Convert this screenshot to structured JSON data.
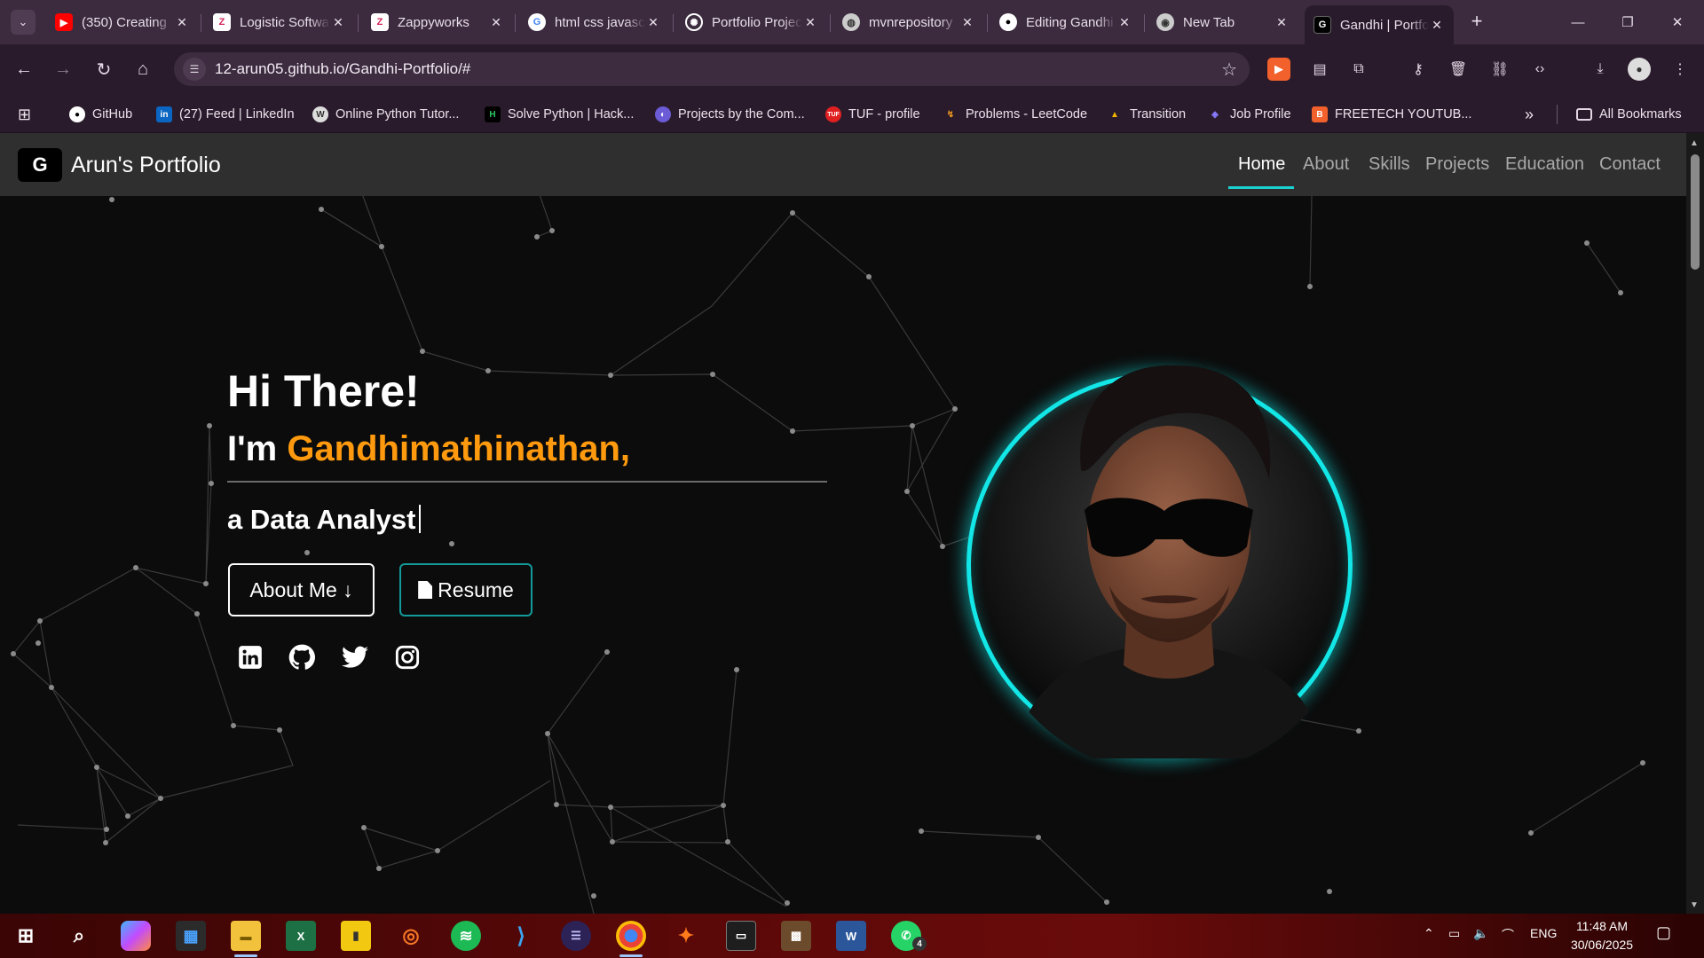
{
  "browser": {
    "tabs": [
      {
        "title": "(350) Creating",
        "icon": "youtube-icon",
        "color": "#ff0000"
      },
      {
        "title": "Logistic Software",
        "icon": "zappy-icon",
        "color": "#ffffff"
      },
      {
        "title": "Zappyworks",
        "icon": "zappy-icon",
        "color": "#ffffff"
      },
      {
        "title": "html css javascript",
        "icon": "google-icon",
        "color": "#ffffff"
      },
      {
        "title": "Portfolio Project",
        "icon": "openai-icon",
        "color": "#ffffff"
      },
      {
        "title": "mvnrepository",
        "icon": "globe-icon",
        "color": "#ffffff"
      },
      {
        "title": "Editing Gandhi",
        "icon": "github-icon",
        "color": "#ffffff"
      },
      {
        "title": "New Tab",
        "icon": "chrome-icon",
        "color": "#ffffff"
      },
      {
        "title": "Gandhi | Portfolio",
        "icon": "portfolio-icon",
        "color": "#000000"
      }
    ],
    "active_tab_index": 8,
    "url": "12-arun05.github.io/Gandhi-Portfolio/#",
    "bookmarks": [
      {
        "label": "GitHub"
      },
      {
        "label": "(27) Feed | LinkedIn"
      },
      {
        "label": "Online Python Tutor..."
      },
      {
        "label": "Solve Python | Hack..."
      },
      {
        "label": "Projects by the Com..."
      },
      {
        "label": "TUF - profile"
      },
      {
        "label": "Problems - LeetCode"
      },
      {
        "label": "Transition"
      },
      {
        "label": "Job Profile"
      },
      {
        "label": "FREETECH YOUTUB..."
      }
    ],
    "bookmarks_more": "»",
    "all_bookmarks": "All Bookmarks"
  },
  "site": {
    "brand": "Arun's Portfolio",
    "nav": [
      "Home",
      "About",
      "Skills",
      "Projects",
      "Education",
      "Contact"
    ],
    "active_nav": "Home",
    "hero": {
      "greeting": "Hi There!",
      "intro_prefix": "I'm ",
      "name": "Gandhimathinathan,",
      "role": "a Data Analyst",
      "about_button": "About Me ↓",
      "resume_button": "Resume",
      "social": [
        "linkedin-icon",
        "github-icon",
        "twitter-icon",
        "instagram-icon"
      ]
    },
    "accent_color": "#13e6e6",
    "name_color": "#ff9a0e"
  },
  "taskbar": {
    "language": "ENG",
    "time": "11:48 AM",
    "date": "30/06/2025",
    "whatsapp_badge": "4"
  }
}
